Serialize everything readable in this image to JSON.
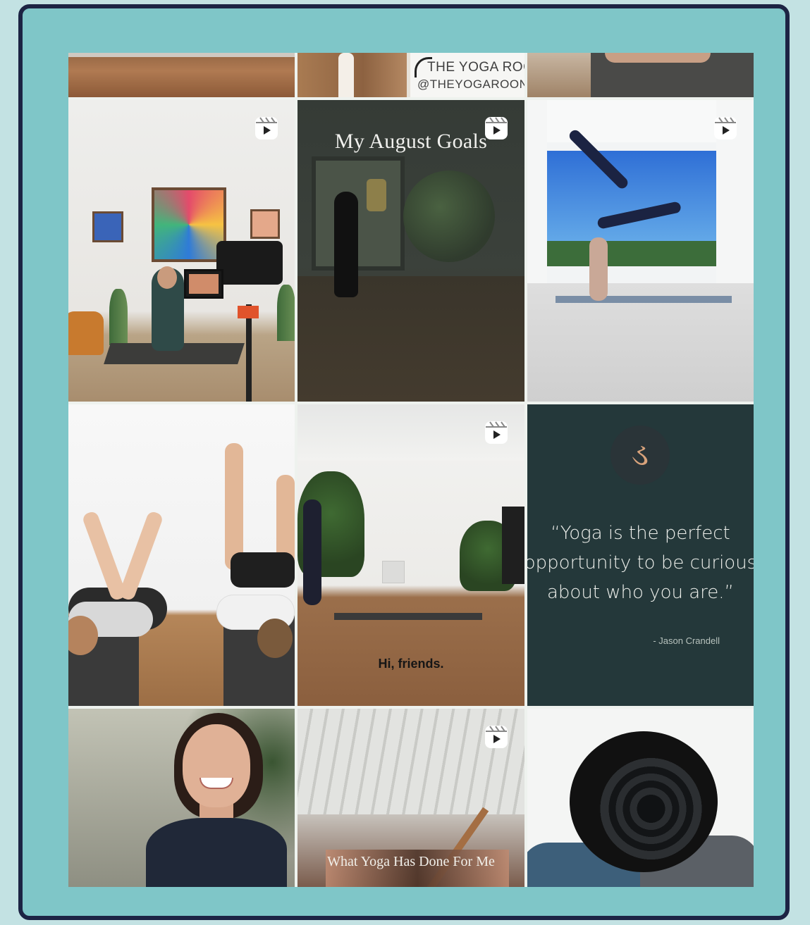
{
  "feed": {
    "top_row": {
      "logo_line1": "THE YOGA ROC",
      "logo_line2": "@THEYOGAROON"
    },
    "tiles": [
      {
        "id": "studio-filming",
        "is_reel": true
      },
      {
        "id": "august-goals",
        "is_reel": true,
        "overlay_text": "My August Goals"
      },
      {
        "id": "headstand-pose",
        "is_reel": true
      },
      {
        "id": "legs-up-wall",
        "is_reel": false
      },
      {
        "id": "hi-friends",
        "is_reel": true,
        "overlay_text": "Hi, friends."
      },
      {
        "id": "quote-card",
        "is_reel": false,
        "quote_line1": "“Yoga is the perfect",
        "quote_line2": "opportunity to be curious",
        "quote_line3": "about who you are.”",
        "author": "- Jason Crandell",
        "logo_glyph": "ડ"
      },
      {
        "id": "instructor-portrait",
        "is_reel": false
      },
      {
        "id": "what-yoga-has-done",
        "is_reel": true,
        "overlay_text": "What Yoga Has Done For Me"
      },
      {
        "id": "rolled-mats",
        "is_reel": false
      }
    ]
  },
  "colors": {
    "page_bg": "#c3e2e3",
    "frame_bg": "#7fc6c8",
    "frame_border": "#1c2444",
    "quote_bg": "#24383a",
    "accent_gold": "#d8a27b"
  },
  "icons": {
    "reel": "reel-play-icon"
  }
}
